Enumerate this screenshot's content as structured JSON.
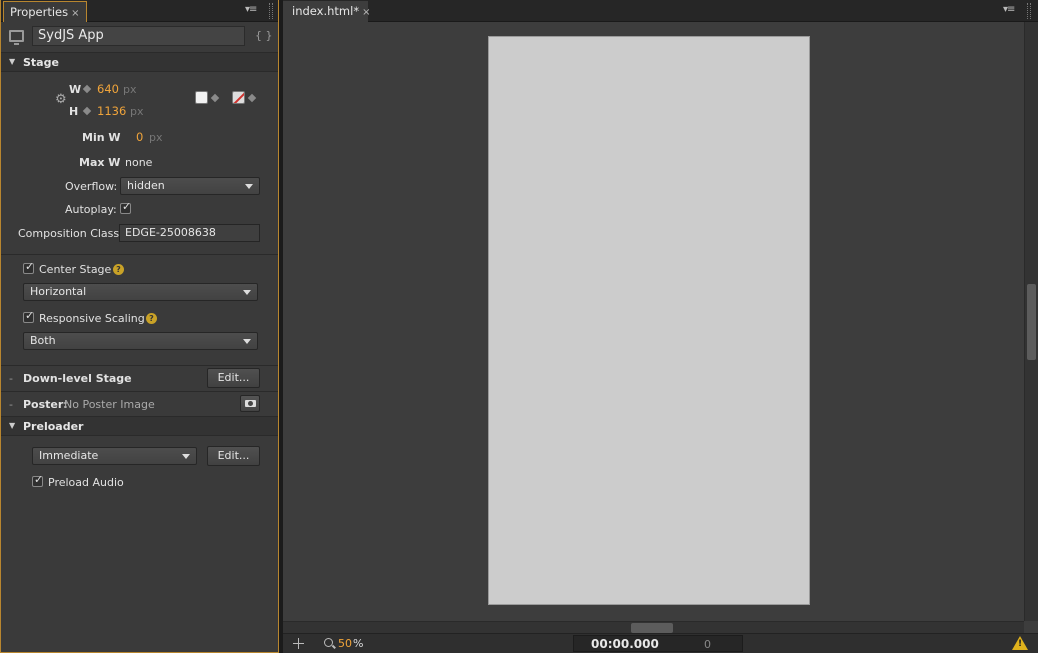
{
  "properties_panel": {
    "tab_label": "Properties",
    "tab_close": "×",
    "composition_name": "SydJS App",
    "code_glyph": "{ }",
    "stage": {
      "section_title": "Stage",
      "width_label": "W",
      "width_value": "640",
      "width_unit": "px",
      "height_label": "H",
      "height_value": "1136",
      "height_unit": "px",
      "min_w_label": "Min W",
      "min_w_value": "0",
      "min_w_unit": "px",
      "max_w_label": "Max W",
      "max_w_value": "none",
      "overflow_label": "Overflow:",
      "overflow_value": "hidden",
      "autoplay_label": "Autoplay:",
      "autoplay_checked": true,
      "composition_class_label": "Composition Class:",
      "composition_class_value": "EDGE-25008638",
      "background_color": "#f2f2f2"
    },
    "center_stage": {
      "label": "Center Stage",
      "checked": true,
      "option": "Horizontal"
    },
    "responsive_scaling": {
      "label": "Responsive Scaling",
      "checked": true,
      "option": "Both"
    },
    "down_level_stage": {
      "label": "Down-level Stage",
      "button": "Edit..."
    },
    "poster": {
      "label": "Poster:",
      "value": "No Poster Image"
    },
    "preloader": {
      "section_title": "Preloader",
      "option": "Immediate",
      "button": "Edit...",
      "preload_audio_label": "Preload Audio",
      "preload_audio_checked": true
    }
  },
  "document": {
    "tab_label": "index.html*",
    "tab_close": "×",
    "canvas_color": "#cccccc"
  },
  "statusbar": {
    "zoom_value": "50",
    "zoom_unit": "%",
    "time": "00:00.000",
    "frame": "0",
    "warning_glyph": "!"
  },
  "colors": {
    "accent": "#f0a43a",
    "panel_border": "#b8862f",
    "panel_bg": "#3a3a3a"
  }
}
